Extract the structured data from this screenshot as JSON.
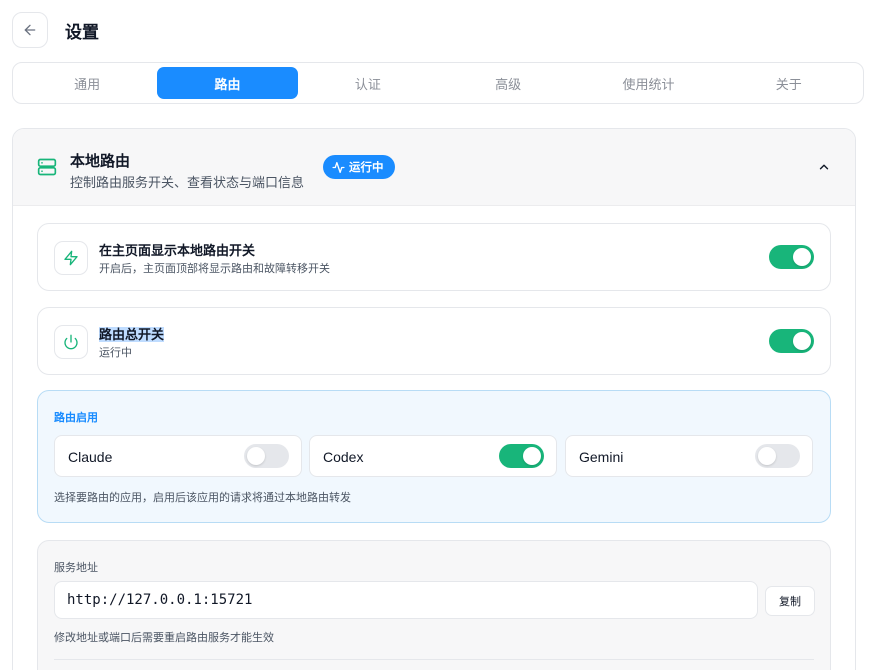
{
  "header": {
    "title": "设置"
  },
  "tabs": [
    {
      "label": "通用",
      "active": false
    },
    {
      "label": "路由",
      "active": true
    },
    {
      "label": "认证",
      "active": false
    },
    {
      "label": "高级",
      "active": false
    },
    {
      "label": "使用统计",
      "active": false
    },
    {
      "label": "关于",
      "active": false
    }
  ],
  "section": {
    "title": "本地路由",
    "subtitle": "控制路由服务开关、查看状态与端口信息",
    "status": "运行中"
  },
  "show_toggle_card": {
    "title": "在主页面显示本地路由开关",
    "subtitle": "开启后，主页面顶部将显示路由和故障转移开关",
    "enabled": true
  },
  "master_switch_card": {
    "title": "路由总开关",
    "subtitle": "运行中",
    "enabled": true
  },
  "apps": {
    "label": "路由启用",
    "items": [
      {
        "name": "Claude",
        "enabled": false
      },
      {
        "name": "Codex",
        "enabled": true
      },
      {
        "name": "Gemini",
        "enabled": false
      }
    ],
    "hint": "选择要路由的应用，启用后该应用的请求将通过本地路由转发"
  },
  "address": {
    "label": "服务地址",
    "value": "http://127.0.0.1:15721",
    "copy_label": "复制",
    "hint": "修改地址或端口后需要重启路由服务才能生效"
  },
  "colors": {
    "accent": "#1a8cff",
    "toggle_on": "#18b57a",
    "toggle_off": "#e5e7eb"
  }
}
